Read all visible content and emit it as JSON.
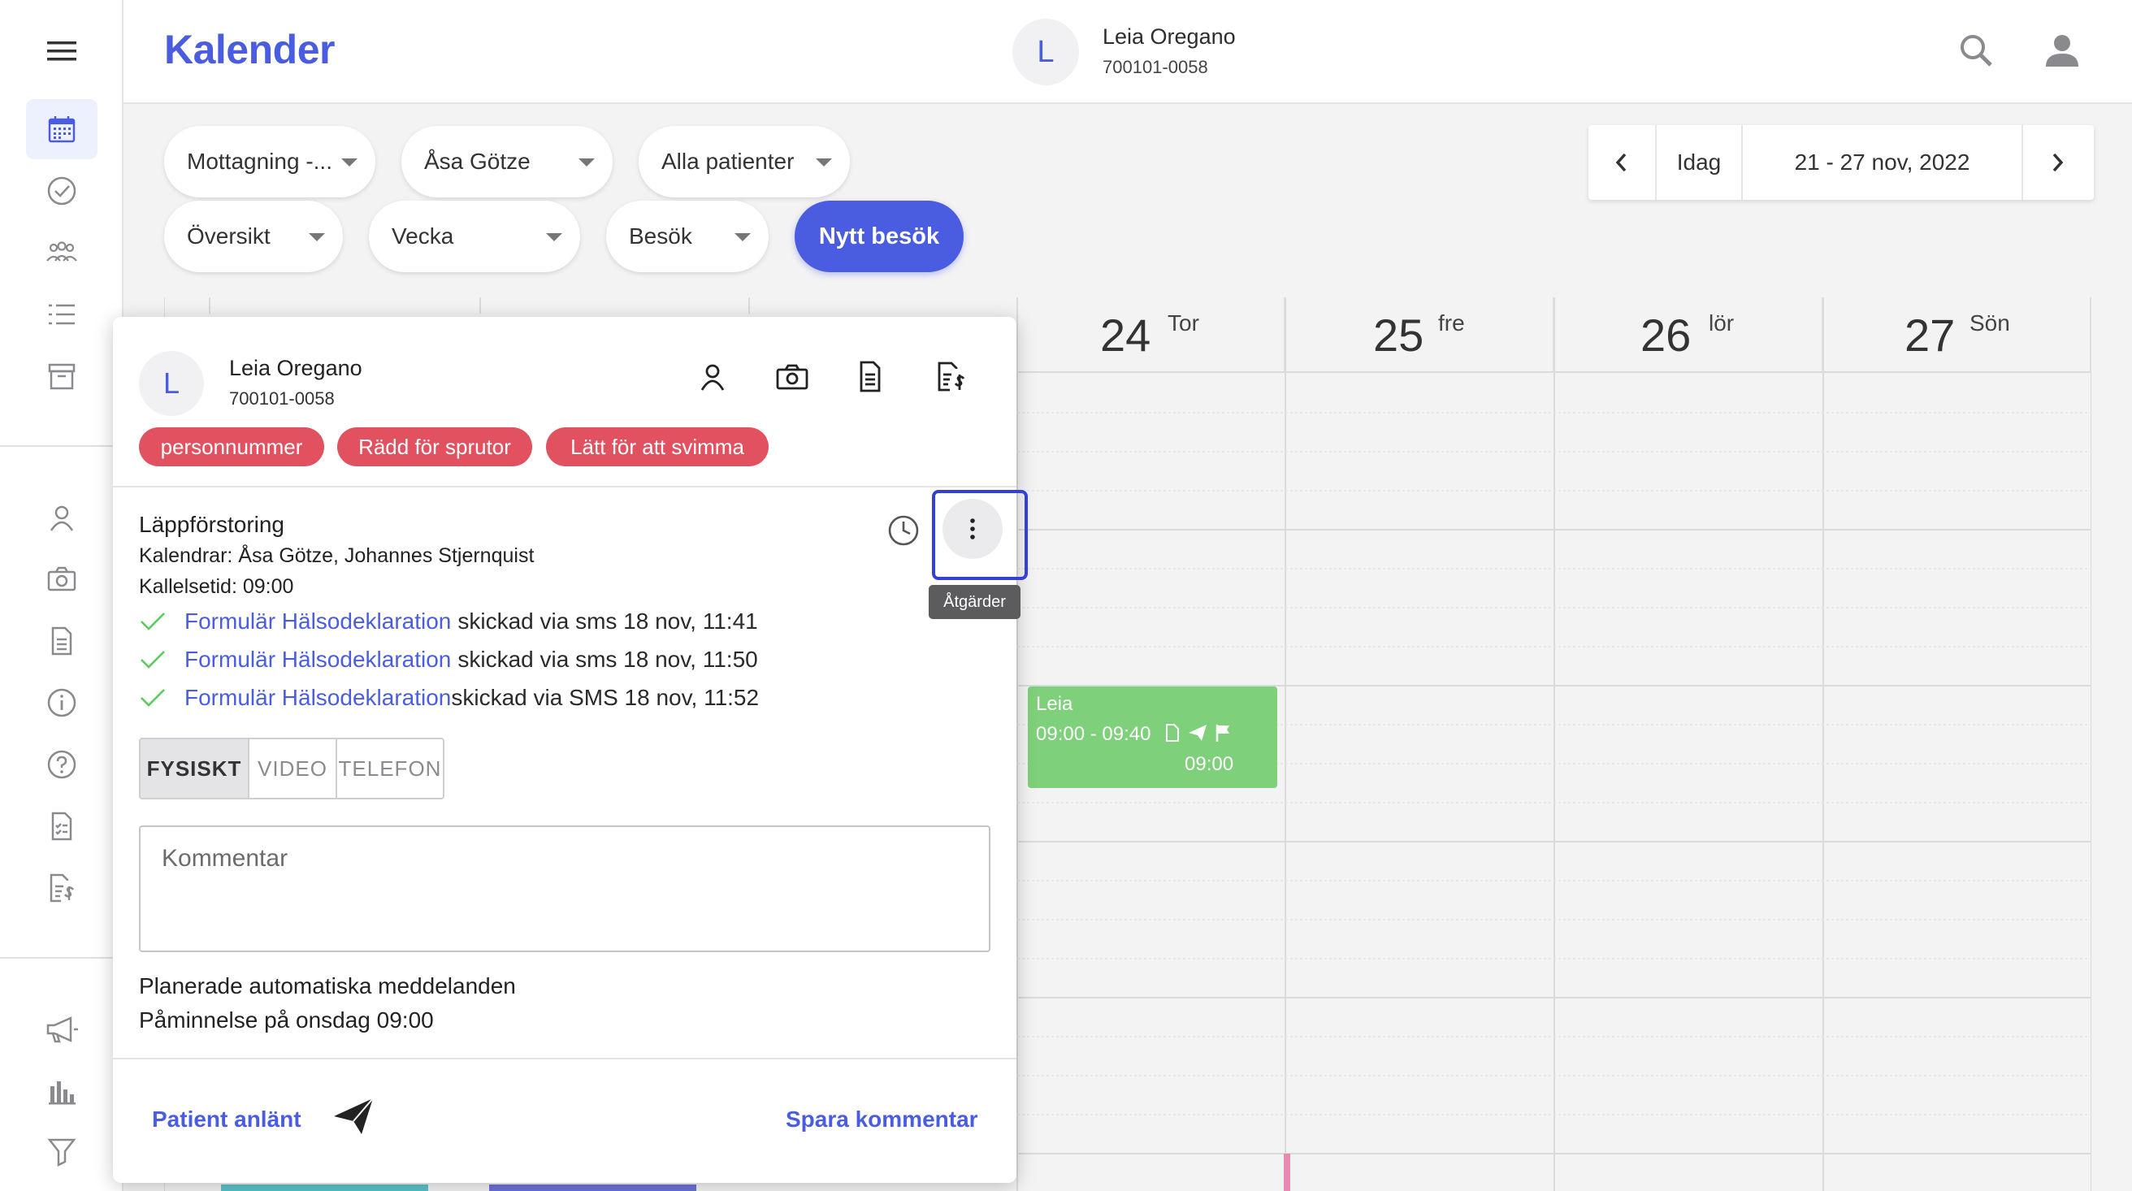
{
  "header": {
    "title": "Kalender",
    "patient_initial": "L",
    "patient_name": "Leia Oregano",
    "patient_pnr": "700101-0058"
  },
  "filters": {
    "row1": [
      "Mottagning -...",
      "Åsa Götze",
      "Alla patienter"
    ],
    "row2": [
      "Översikt",
      "Vecka",
      "Besök"
    ],
    "new_visit": "Nytt besök"
  },
  "date_nav": {
    "today": "Idag",
    "range": "21 - 27 nov, 2022"
  },
  "calendar": {
    "days": [
      {
        "num": "24",
        "name": "Tor"
      },
      {
        "num": "25",
        "name": "fre"
      },
      {
        "num": "26",
        "name": "lör"
      },
      {
        "num": "27",
        "name": "Sön"
      }
    ],
    "event": {
      "name": "Leia",
      "time": "09:00 - 09:40",
      "call_time": "09:00",
      "color": "#7ed07a"
    }
  },
  "popup": {
    "initial": "L",
    "name": "Leia Oregano",
    "pnr": "700101-0058",
    "tags": [
      "personnummer",
      "Rädd för sprutor",
      "Lätt för att svimma"
    ],
    "visit_type": "Läppförstoring",
    "calendars": "Kalendrar: Åsa Götze, Johannes Stjernquist",
    "call_time": "Kallelsetid: 09:00",
    "forms": [
      {
        "link": "Formulär Hälsodeklaration",
        "text": "skickad via sms 18 nov, 11:41"
      },
      {
        "link": "Formulär Hälsodeklaration",
        "text": "skickad via sms 18 nov, 11:50"
      },
      {
        "link": "Formulär Hälsodeklaration",
        "text": "skickad via SMS 18 nov, 11:52"
      }
    ],
    "modes": [
      "FYSISKT",
      "VIDEO",
      "TELEFON"
    ],
    "comment_placeholder": "Kommentar",
    "planned_title": "Planerade automatiska meddelanden",
    "planned_item": "Påminnelse på onsdag 09:00",
    "patient_arrived": "Patient anlänt",
    "save_comment": "Spara kommentar",
    "actions_tooltip": "Åtgärder"
  },
  "colors": {
    "accent": "#4a5de0",
    "tag": "#e2515f",
    "check": "#5cc95f"
  }
}
